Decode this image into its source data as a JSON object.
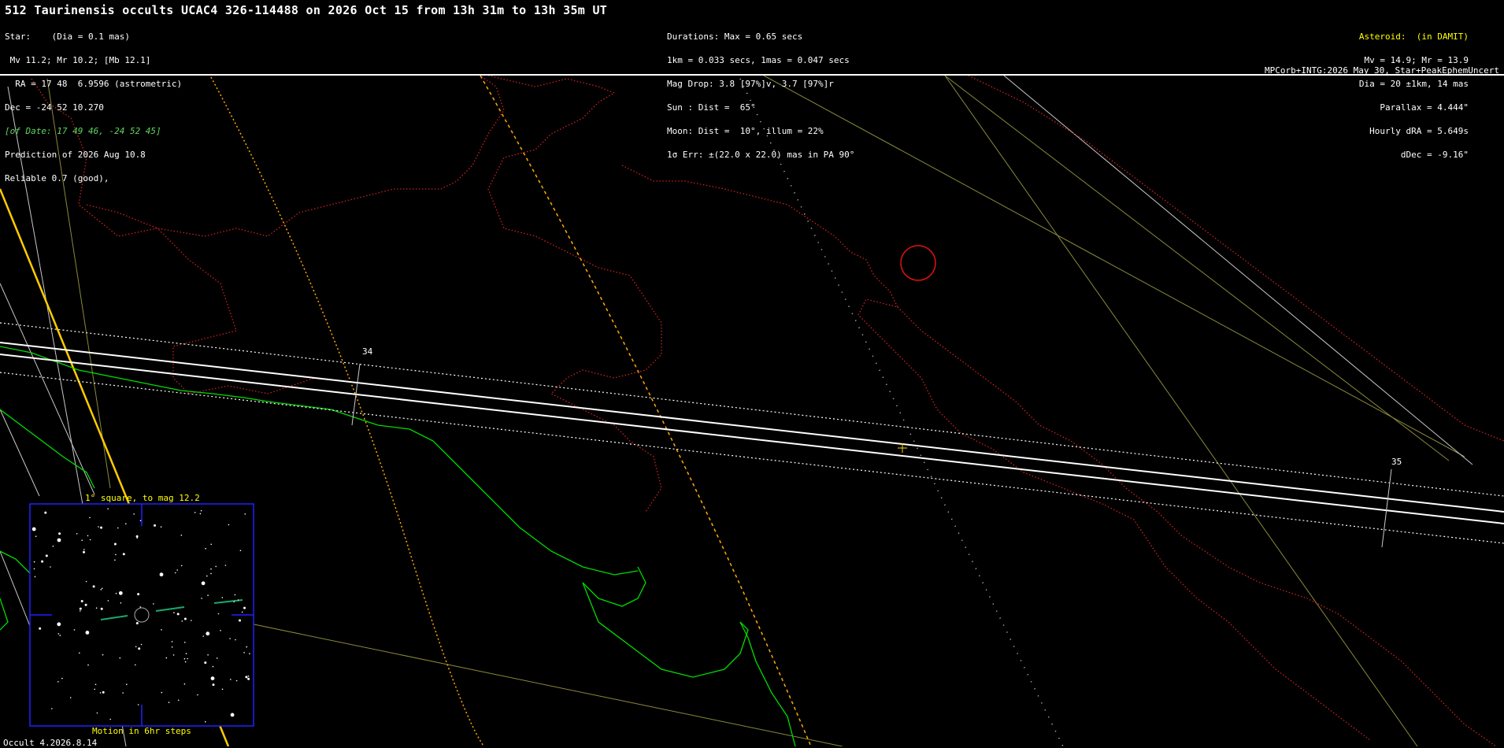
{
  "header": {
    "title": "512 Taurinensis occults UCAC4 326-114488 on 2026 Oct 15 from 13h 31m to 13h 35m UT",
    "star_lines": [
      "Star:    (Dia = 0.1 mas)",
      " Mv 11.2; Mr 10.2; [Mb 12.1]",
      "  RA = 17 48  6.9596 (astrometric)",
      "Dec = -24 52 10.270"
    ],
    "of_date": "[of Date: 17 49 46, -24 52 45]",
    "prediction": "Prediction of 2026 Aug 10.8",
    "reliable": "Reliable 0.7 (good),",
    "mid_lines": [
      "Durations: Max = 0.65 secs",
      "1km = 0.033 secs, 1mas = 0.047 secs",
      "Mag Drop: 3.8 [97%]v, 3.7 [97%]r",
      "Sun : Dist =  65°",
      "Moon: Dist =  10°, illum = 22%",
      "1σ Err: ±(22.0 x 22.0) mas in PA 90°"
    ],
    "asteroid_label": "Asteroid:  (in DAMIT)",
    "right_lines": [
      "Mv = 14.9; Mr = 13.9",
      "Dia = 20 ±1km, 14 mas",
      "Parallax = 4.444\"",
      "Hourly dRA = 5.649s",
      "dDec = -9.16\""
    ],
    "source": "MPCorb+INTG:2026 May 30, Star+PeakEphemUncert"
  },
  "map": {
    "time_labels": [
      "34",
      "35"
    ],
    "colors": {
      "coast": "#00dd00",
      "border": "#cc2222",
      "path": "#ffffff",
      "sun_limit": "#ffcc00",
      "grid": "#8a8a2a"
    }
  },
  "inset": {
    "caption_top": "1° square, to mag 12.2",
    "caption_bottom": "Motion in 6hr steps"
  },
  "footer": "Occult 4.2026.8.14"
}
